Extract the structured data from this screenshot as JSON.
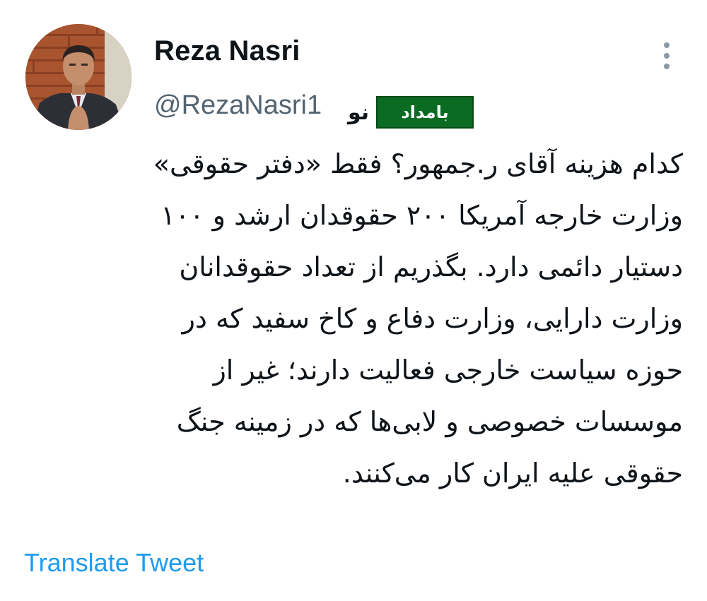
{
  "author": {
    "display_name": "Reza Nasri",
    "handle": "@RezaNasri1"
  },
  "watermark": {
    "box_text": "بامداد",
    "side_text": "نو",
    "box_color": "#0b6b22"
  },
  "tweet": {
    "lines": [
      "کدام هزینه آقای ر.جمهور؟ فقط «دفتر حقوقی»",
      "وزارت خارجه آمریکا ۲۰۰ حقوقدان ارشد و ۱۰۰",
      "دستیار دائمی دارد. بگذریم از تعداد حقوقدانان",
      "وزارت دارایی، وزارت دفاع و کاخ سفید که در",
      "حوزه سیاست خارجی فعالیت دارند؛ غیر از",
      "موسسات خصوصی و لابی‌ها که در زمینه جنگ",
      "حقوقی علیه ایران کار می‌کنند."
    ]
  },
  "actions": {
    "translate_label": "Translate Tweet",
    "more_icon": "more-vertical-icon"
  },
  "colors": {
    "link": "#1d9bf0",
    "secondary_text": "#536471",
    "primary_text": "#0f1419"
  }
}
